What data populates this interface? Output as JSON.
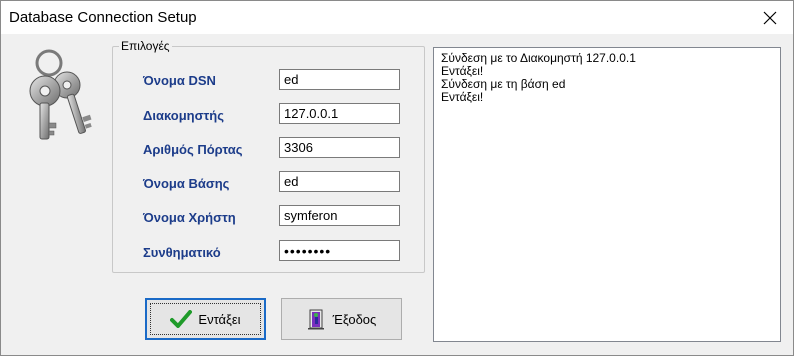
{
  "window": {
    "title": "Database Connection Setup"
  },
  "group": {
    "legend": "Επιλογές"
  },
  "fields": [
    {
      "label": "Όνομα DSN",
      "value": "ed"
    },
    {
      "label": "Διακομηστής",
      "value": "127.0.0.1"
    },
    {
      "label": "Αριθμός Πόρτας",
      "value": "3306"
    },
    {
      "label": "Όνομα Βάσης",
      "value": "ed"
    },
    {
      "label": "Όνομα Χρήστη",
      "value": "symferon"
    },
    {
      "label": "Συνθηματικό",
      "value": "••••••••"
    }
  ],
  "buttons": {
    "ok_label": "Εντάξει",
    "exit_label": "Έξοδος"
  },
  "log": {
    "lines": [
      "Σύνδεση με το Διακομηστή 127.0.0.1",
      "Εντάξει!",
      "Σύνδεση με τη βάση ed",
      "Εντάξει!"
    ]
  },
  "icons": {
    "keys": "keys-icon",
    "ok": "checkmark-icon",
    "exit": "exit-door-icon",
    "close": "close-icon"
  },
  "colors": {
    "label_text": "#1c3c8a",
    "default_button_border": "#1a6ac7",
    "checkmark": "#1f9b2a"
  }
}
